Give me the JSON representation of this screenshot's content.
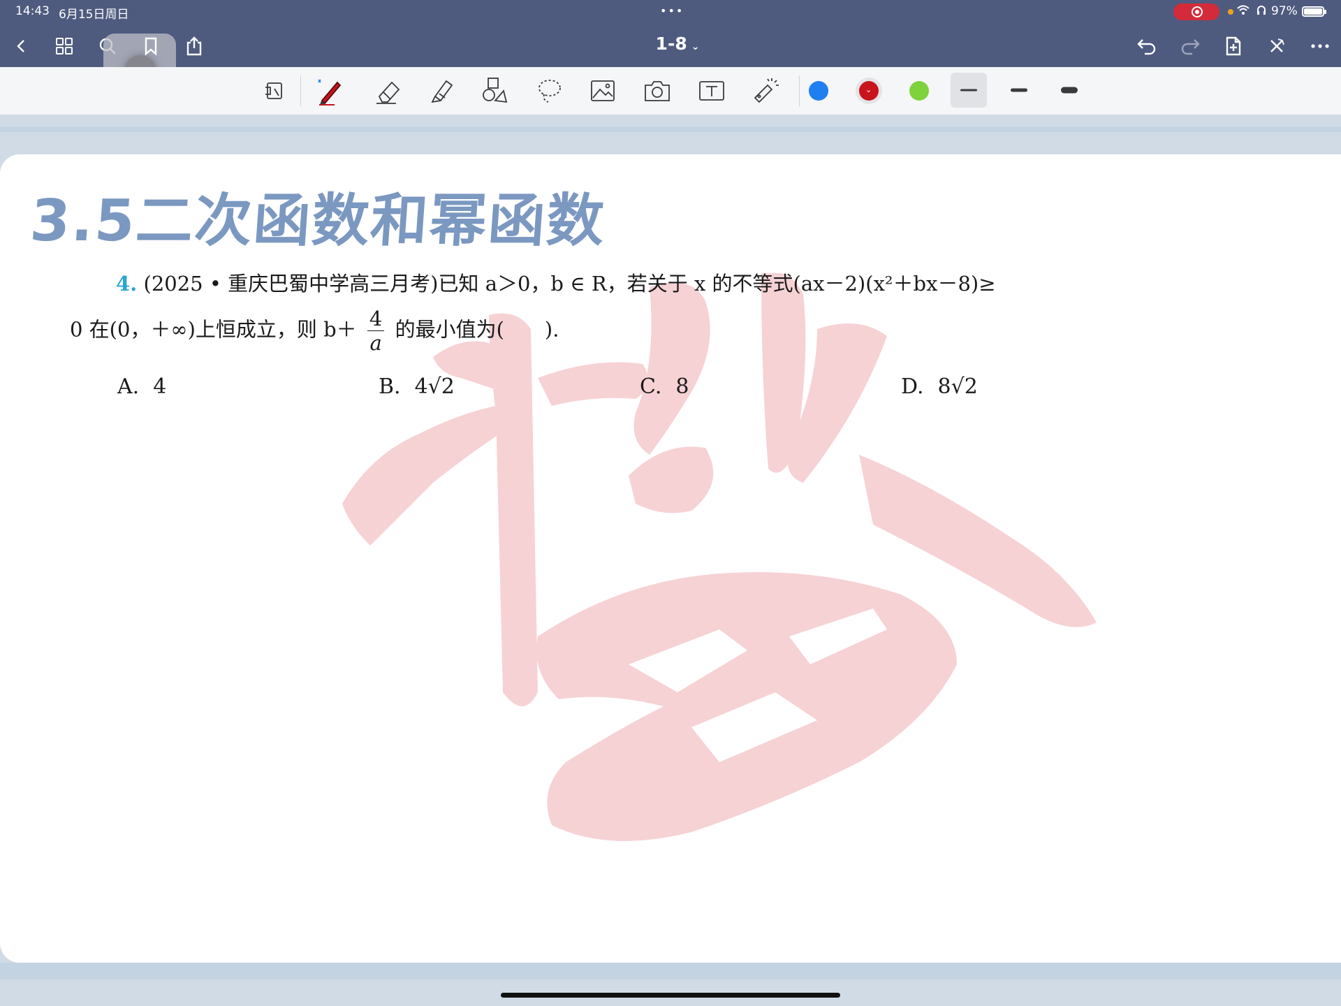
{
  "status_bar": {
    "time": "14:43",
    "date": "6月15日周日",
    "center_dots": "•••",
    "battery": "97%"
  },
  "nav": {
    "title": "1-8",
    "title_chevron": "⌄",
    "icons": [
      "back-icon",
      "grid-icon",
      "search-icon",
      "bookmark-icon",
      "share-icon",
      "undo-icon",
      "redo-icon",
      "add-page-icon",
      "close-icon",
      "more-icon"
    ]
  },
  "toolbar": {
    "tools": [
      "page-icon",
      "pen-icon",
      "eraser-icon",
      "highlighter-icon",
      "shapes-icon",
      "lasso-icon",
      "image-icon",
      "camera-icon",
      "text-icon",
      "laser-pointer-icon"
    ],
    "colors": [
      "#1f7ff0",
      "#c8141c",
      "#7ed23b"
    ],
    "selected_color_chevron": "⌄"
  },
  "document": {
    "title": "3.5二次函数和幂函数",
    "question": {
      "number": "4.",
      "line1": "(2025 • 重庆巴蜀中学高三月考)已知 a＞0，b ∈ R，若关于 x 的不等式(ax－2)(x²＋bx－8)≥",
      "line2_pre": "0 在(0，＋∞)上恒成立，则 b＋",
      "frac_num": "4",
      "frac_den": "a",
      "line2_post": "的最小值为(　　)."
    },
    "options": [
      {
        "label": "A.",
        "value": "4"
      },
      {
        "label": "B.",
        "value": "4√2"
      },
      {
        "label": "C.",
        "value": "8"
      },
      {
        "label": "D.",
        "value": "8√2"
      }
    ]
  }
}
